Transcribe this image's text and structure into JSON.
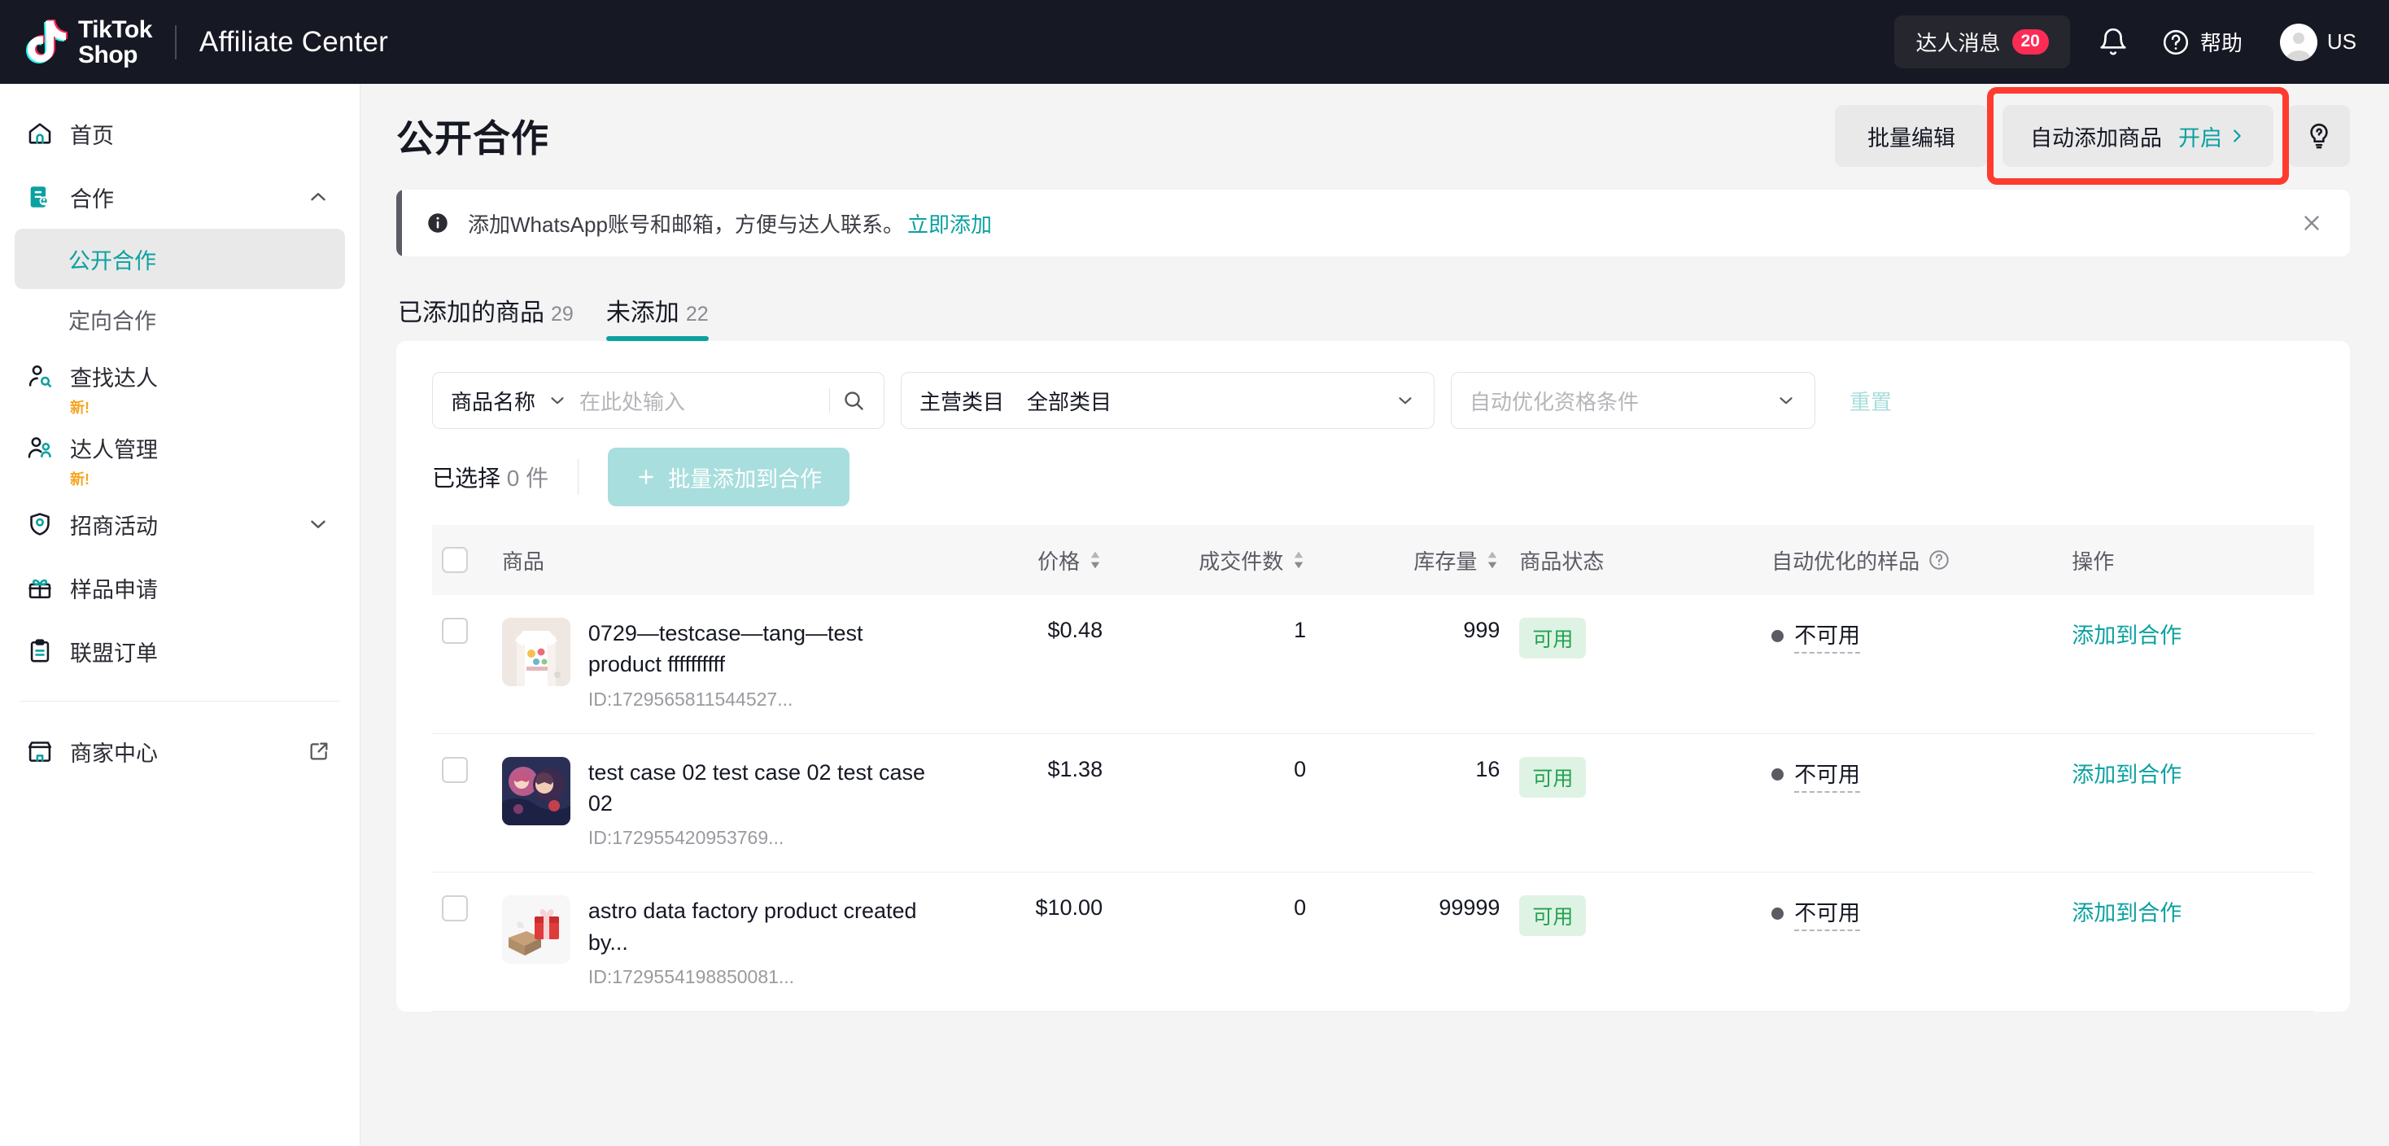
{
  "colors": {
    "accent": "#0ca1a0",
    "brand_dark": "#161823",
    "badge_red": "#fe2c55",
    "highlight": "#ff3b30",
    "ok_green": "#22a251"
  },
  "topbar": {
    "logo_line1": "TikTok",
    "logo_line2": "Shop",
    "app_title": "Affiliate Center",
    "messages_label": "达人消息",
    "messages_badge": "20",
    "bell_icon": "bell-icon",
    "help_label": "帮助",
    "help_icon": "question-circle-icon",
    "region_label": "US",
    "avatar_icon": "avatar"
  },
  "sidebar": {
    "items": [
      {
        "label": "首页",
        "icon": "home-icon",
        "type": "link"
      },
      {
        "label": "合作",
        "icon": "collab-icon",
        "type": "group",
        "expanded": true,
        "chevron": "chevron-up-icon"
      },
      {
        "label": "公开合作",
        "type": "sub",
        "active": true
      },
      {
        "label": "定向合作",
        "type": "sub",
        "active": false
      },
      {
        "label": "查找达人",
        "icon": "person-search-icon",
        "type": "link",
        "badge": "新!"
      },
      {
        "label": "达人管理",
        "icon": "people-icon",
        "type": "link",
        "badge": "新!"
      },
      {
        "label": "招商活动",
        "icon": "shield-icon",
        "type": "group",
        "expanded": false,
        "chevron": "chevron-down-icon"
      },
      {
        "label": "样品申请",
        "icon": "gift-icon",
        "type": "link"
      },
      {
        "label": "联盟订单",
        "icon": "clipboard-icon",
        "type": "link"
      },
      {
        "label": "商家中心",
        "icon": "store-icon",
        "type": "link",
        "external": true,
        "external_icon": "external-link-icon"
      }
    ]
  },
  "page": {
    "title": "公开合作",
    "actions": {
      "bulk_edit": "批量编辑",
      "auto_add_label": "自动添加商品",
      "auto_add_state": "开启",
      "auto_add_chevron": "chevron-right-icon",
      "help_icon": "lightbulb-question-icon",
      "highlight_target": "auto-add-products-button"
    }
  },
  "banner": {
    "info_icon": "info-icon",
    "text": "添加WhatsApp账号和邮箱，方便与达人联系。",
    "link": "立即添加",
    "close_icon": "close-icon"
  },
  "tabs": [
    {
      "label": "已添加的商品",
      "count": "29",
      "active": false
    },
    {
      "label": "未添加",
      "count": "22",
      "active": true
    }
  ],
  "filters": {
    "name_field": {
      "label": "商品名称",
      "chevron": "chevron-down-icon",
      "placeholder": "在此处输入",
      "value": "",
      "search_icon": "search-icon"
    },
    "category_field": {
      "label": "主营类目",
      "value": "全部类目",
      "chevron": "chevron-down-icon"
    },
    "eligibility_field": {
      "placeholder": "自动优化资格条件",
      "value": "",
      "chevron": "chevron-down-icon"
    },
    "reset_label": "重置"
  },
  "selection": {
    "prefix": "已选择",
    "count": "0",
    "unit": "件",
    "bulk_button_label": "批量添加到合作",
    "bulk_button_icon": "plus-icon"
  },
  "table": {
    "columns": [
      {
        "key": "checkbox",
        "label": "",
        "sortable": false
      },
      {
        "key": "product",
        "label": "商品",
        "sortable": false
      },
      {
        "key": "price",
        "label": "价格",
        "sortable": true,
        "align": "right"
      },
      {
        "key": "deals",
        "label": "成交件数",
        "sortable": true,
        "align": "right"
      },
      {
        "key": "stock",
        "label": "库存量",
        "sortable": true,
        "align": "right"
      },
      {
        "key": "status",
        "label": "商品状态",
        "sortable": false
      },
      {
        "key": "sample",
        "label": "自动优化的样品",
        "sortable": false,
        "info_icon": "question-circle-icon"
      },
      {
        "key": "op",
        "label": "操作",
        "sortable": false
      }
    ],
    "rows": [
      {
        "checked": false,
        "thumb": "tshirt-thumbnail",
        "name": "0729—testcase—tang—test product ffffffffff",
        "id": "ID:1729565811544527...",
        "price": "$0.48",
        "deals": "1",
        "stock": "999",
        "status": "可用",
        "sample": "不可用",
        "action": "添加到合作"
      },
      {
        "checked": false,
        "thumb": "anime-thumbnail",
        "name": "test case 02 test case 02 test case 02",
        "id": "ID:172955420953769...",
        "price": "$1.38",
        "deals": "0",
        "stock": "16",
        "status": "可用",
        "sample": "不可用",
        "action": "添加到合作"
      },
      {
        "checked": false,
        "thumb": "gift-box-thumbnail",
        "name": "astro data factory product created by...",
        "id": "ID:1729554198850081...",
        "price": "$10.00",
        "deals": "0",
        "stock": "99999",
        "status": "可用",
        "sample": "不可用",
        "action": "添加到合作"
      }
    ]
  }
}
